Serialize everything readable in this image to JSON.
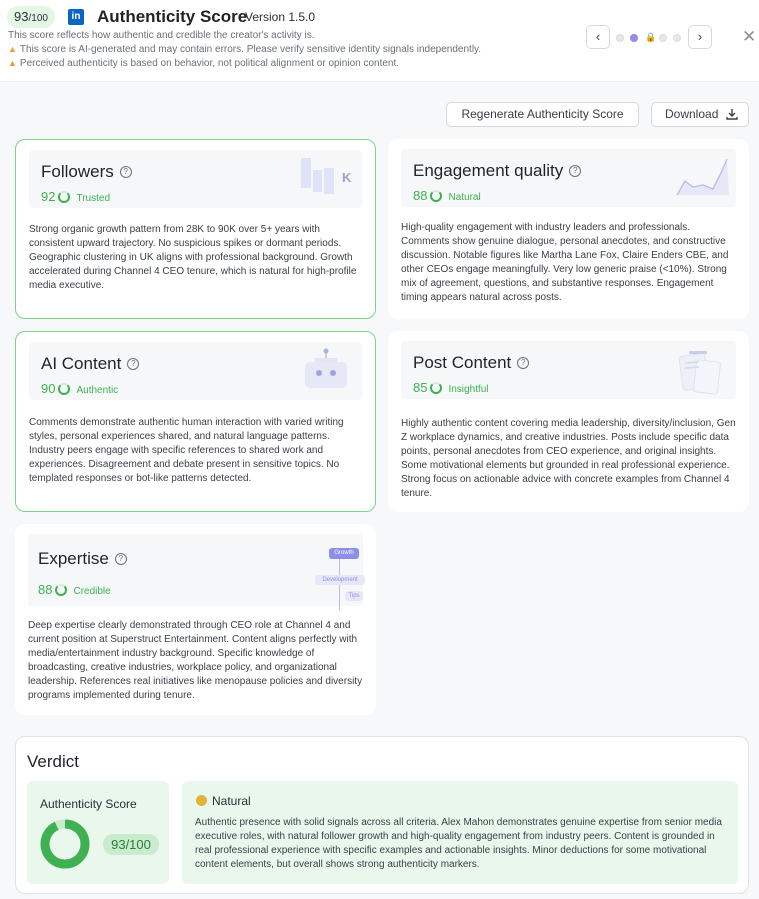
{
  "header": {
    "score": "93",
    "score_total": "/100",
    "logo_text": "in",
    "title": "Authenticity Score",
    "version": "Version 1.5.0",
    "description": "This score reflects how authentic and credible the creator's activity is.",
    "warnings": [
      "This score is AI-generated and may contain errors. Please verify sensitive identity signals independently.",
      "Perceived authenticity is based on behavior, not political alignment or opinion content."
    ],
    "prev_icon": "‹",
    "next_icon": "›",
    "close_icon": "✕"
  },
  "toolbar": {
    "regenerate_label": "Regenerate Authenticity Score",
    "download_label": "Download"
  },
  "cards": {
    "followers": {
      "title": "Followers",
      "score": "92",
      "label": "Trusted",
      "deco_text": "K",
      "body": "Strong organic growth pattern from 28K to 90K over 5+ years with consistent upward trajectory. No suspicious spikes or dormant periods. Geographic clustering in UK aligns with professional background. Growth accelerated during Channel 4 CEO tenure, which is natural for high-profile media executive."
    },
    "engagement": {
      "title": "Engagement quality",
      "score": "88",
      "label": "Natural",
      "body": "High-quality engagement with industry leaders and professionals. Comments show genuine dialogue, personal anecdotes, and constructive discussion. Notable figures like Martha Lane Fox, Claire Enders CBE, and other CEOs engage meaningfully. Very low generic praise (<10%). Strong mix of agreement, questions, and substantive responses. Engagement timing appears natural across posts."
    },
    "ai_content": {
      "title": "AI Content",
      "score": "90",
      "label": "Authentic",
      "body": "Comments demonstrate authentic human interaction with varied writing styles, personal experiences shared, and natural language patterns. Industry peers engage with specific references to shared work and experiences. Disagreement and debate present in sensitive topics. No templated responses or bot-like patterns detected."
    },
    "post_content": {
      "title": "Post Content",
      "score": "85",
      "label": "Insightful",
      "body": "Highly authentic content covering media leadership, diversity/inclusion, Gen Z workplace dynamics, and creative industries. Posts include specific data points, personal anecdotes from CEO experience, and original insights. Some motivational elements but grounded in real professional experience. Strong focus on actionable advice with concrete examples from Channel 4 tenure."
    },
    "expertise": {
      "title": "Expertise",
      "score": "88",
      "label": "Credible",
      "deco": [
        "Growth",
        "Development",
        "Tips"
      ],
      "body": "Deep expertise clearly demonstrated through CEO role at Channel 4 and current position at Superstruct Entertainment. Content aligns perfectly with media/entertainment industry background. Specific knowledge of broadcasting, creative industries, workplace policy, and organizational leadership. References real initiatives like menopause policies and diversity programs implemented during tenure."
    }
  },
  "verdict": {
    "title": "Verdict",
    "score_label": "Authenticity Score",
    "score_value": 93,
    "score_text": "93/100",
    "tag": "Natural",
    "text": "Authentic presence with solid signals across all criteria. Alex Mahon demonstrates genuine expertise from senior media executive roles, with natural follower growth and high-quality engagement from industry peers. Content is grounded in real professional experience with specific examples and actionable insights. Minor deductions for some motivational content elements, but overall shows strong authenticity markers."
  },
  "colors": {
    "accent_green": "#3fb153",
    "card_border_green": "#7fd28c",
    "verdict_bg": "#eaf7ec",
    "dot_active": "#8d8ee6",
    "linkedin_blue": "#0a66c2"
  }
}
